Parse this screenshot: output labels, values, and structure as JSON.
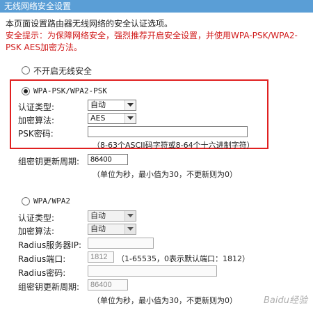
{
  "window": {
    "title": "无线网络安全设置"
  },
  "intro": {
    "line1": "本页面设置路由器无线网络的安全认证选项。",
    "warning": "安全提示：为保障网络安全，强烈推荐开启安全设置，并使用WPA-PSK/WPA2-PSK AES加密方法。"
  },
  "no_security": {
    "label": "不开启无线安全",
    "selected": false
  },
  "wpa_psk": {
    "label": "WPA-PSK/WPA2-PSK",
    "selected": true,
    "auth_type_label": "认证类型:",
    "auth_type_value": "自动",
    "encryption_label": "加密算法:",
    "encryption_value": "AES",
    "psk_label": "PSK密码:",
    "psk_value": "",
    "psk_hint": "（8-63个ASCII码字符或8-64个十六进制字符）",
    "group_key_label": "组密钥更新周期:",
    "group_key_value": "86400",
    "group_key_hint": "（单位为秒，最小值为30，不更新则为0）"
  },
  "wpa": {
    "label": "WPA/WPA2",
    "selected": false,
    "auth_type_label": "认证类型:",
    "auth_type_value": "自动",
    "encryption_label": "加密算法:",
    "encryption_value": "自动",
    "radius_ip_label": "Radius服务器IP:",
    "radius_ip_value": "",
    "radius_port_label": "Radius端口:",
    "radius_port_value": "1812",
    "radius_port_hint": "（1-65535，0表示默认端口：1812）",
    "radius_pwd_label": "Radius密码:",
    "radius_pwd_value": "",
    "group_key_label": "组密钥更新周期:",
    "group_key_value": "86400",
    "group_key_hint": "（单位为秒，最小值为30，不更新则为0）"
  },
  "watermark": "Baidu经验",
  "colors": {
    "title_bar": "#5a9ed6",
    "warning": "#d01b1b",
    "highlight": "#e02020"
  }
}
